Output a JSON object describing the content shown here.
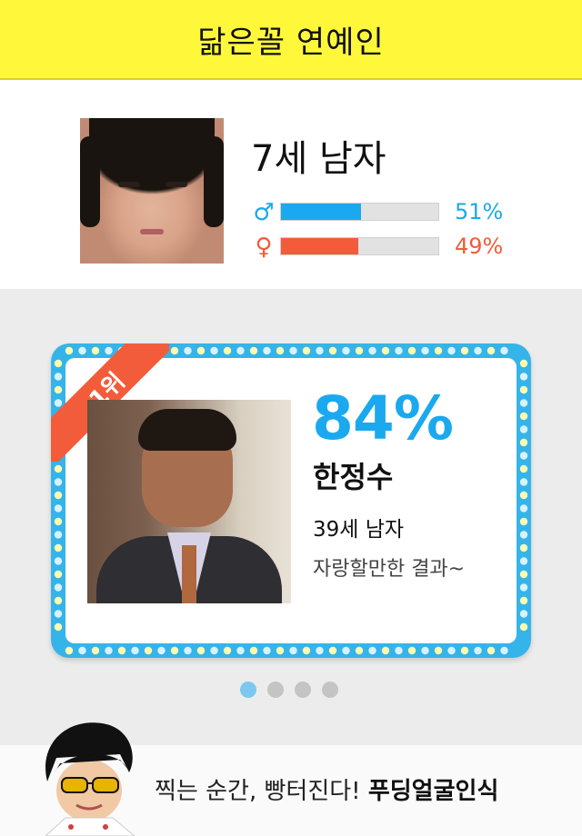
{
  "header": {
    "title": "닮은꼴 연예인"
  },
  "profile": {
    "age_gender": "7세 남자",
    "male": {
      "symbol": "♂",
      "percent": "51%",
      "value": 51,
      "color": "#1aa9ef"
    },
    "female": {
      "symbol": "♀",
      "percent": "49%",
      "value": 49,
      "color": "#f25c3a"
    }
  },
  "result": {
    "rank": "1위",
    "match_percent": "84%",
    "name": "한정수",
    "age_gender": "39세 남자",
    "comment": "자랑할만한 결과~"
  },
  "pagination": {
    "total": 4,
    "active": 1
  },
  "footer": {
    "slogan_prefix": "찍는 순간, 빵터진다!",
    "slogan_brand": "푸딩얼굴인식"
  },
  "colors": {
    "header_bg": "#fff83a",
    "accent_blue": "#1aa9ef",
    "accent_orange": "#f25c3a",
    "frame_blue": "#35b4ea"
  },
  "icons": [
    "male-icon",
    "female-icon",
    "mascot-icon"
  ]
}
